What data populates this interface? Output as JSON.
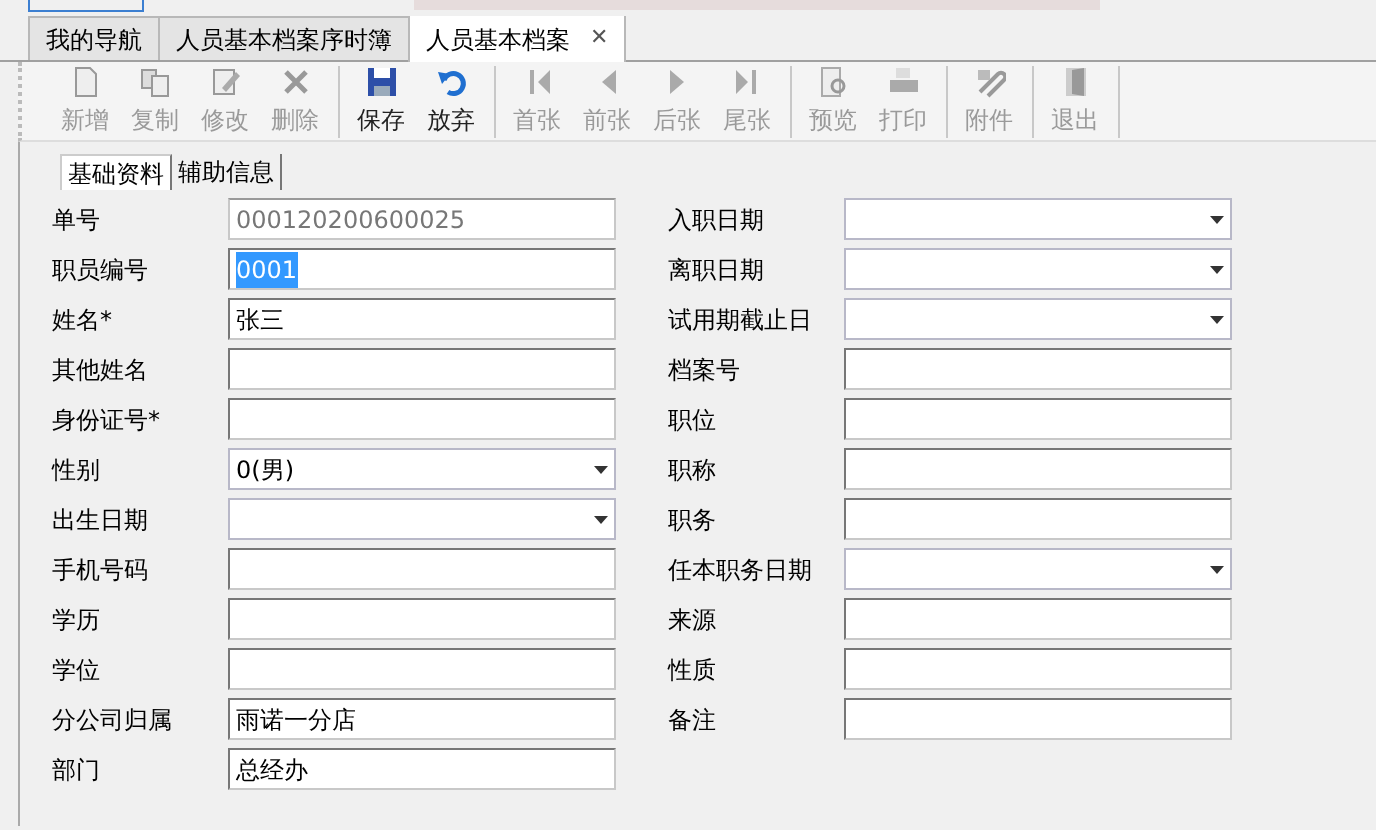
{
  "tabs": [
    {
      "label": "我的导航",
      "selected": false,
      "closable": false
    },
    {
      "label": "人员基本档案序时簿",
      "selected": false,
      "closable": false
    },
    {
      "label": "人员基本档案",
      "selected": true,
      "closable": true,
      "close": "✕"
    }
  ],
  "toolbar": [
    {
      "label": "新增",
      "disabled": true,
      "group_end": false
    },
    {
      "label": "复制",
      "disabled": true,
      "group_end": false
    },
    {
      "label": "修改",
      "disabled": true,
      "group_end": false
    },
    {
      "label": "删除",
      "disabled": true,
      "group_end": true
    },
    {
      "label": "保存",
      "disabled": false,
      "group_end": false
    },
    {
      "label": "放弃",
      "disabled": false,
      "group_end": true
    },
    {
      "label": "首张",
      "disabled": true,
      "group_end": false
    },
    {
      "label": "前张",
      "disabled": true,
      "group_end": false
    },
    {
      "label": "后张",
      "disabled": true,
      "group_end": false
    },
    {
      "label": "尾张",
      "disabled": true,
      "group_end": true
    },
    {
      "label": "预览",
      "disabled": true,
      "group_end": false
    },
    {
      "label": "打印",
      "disabled": true,
      "group_end": true
    },
    {
      "label": "附件",
      "disabled": true,
      "group_end": true
    },
    {
      "label": "退出",
      "disabled": true,
      "group_end": true
    }
  ],
  "subtabs": [
    {
      "label": "基础资料",
      "selected": true
    },
    {
      "label": "辅助信息",
      "selected": false
    }
  ],
  "left_fields": [
    {
      "label": "单号",
      "kind": "readonly",
      "value": "000120200600025"
    },
    {
      "label": "职员编号",
      "kind": "text",
      "value": "0001",
      "highlighted": true
    },
    {
      "label": "姓名*",
      "kind": "text",
      "value": "张三"
    },
    {
      "label": "其他姓名",
      "kind": "text"
    },
    {
      "label": "身份证号*",
      "kind": "text"
    },
    {
      "label": "性别",
      "kind": "combo",
      "value": "0(男)"
    },
    {
      "label": "出生日期",
      "kind": "combo"
    },
    {
      "label": "手机号码",
      "kind": "text"
    },
    {
      "label": "学历",
      "kind": "text"
    },
    {
      "label": "学位",
      "kind": "text"
    },
    {
      "label": "分公司归属",
      "kind": "text",
      "value": "雨诺一分店"
    },
    {
      "label": "部门",
      "kind": "text",
      "value": "总经办"
    }
  ],
  "right_fields": [
    {
      "label": "入职日期",
      "kind": "combo"
    },
    {
      "label": "离职日期",
      "kind": "combo"
    },
    {
      "label": "试用期截止日",
      "kind": "combo"
    },
    {
      "label": "档案号",
      "kind": "text"
    },
    {
      "label": "职位",
      "kind": "text"
    },
    {
      "label": "职称",
      "kind": "text"
    },
    {
      "label": "职务",
      "kind": "text"
    },
    {
      "label": "任本职务日期",
      "kind": "combo"
    },
    {
      "label": "来源",
      "kind": "text"
    },
    {
      "label": "性质",
      "kind": "text"
    },
    {
      "label": "备注",
      "kind": "text"
    }
  ]
}
